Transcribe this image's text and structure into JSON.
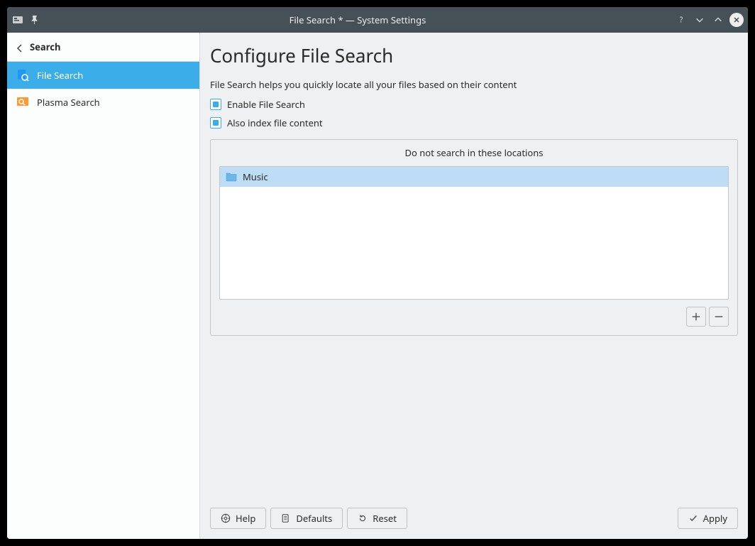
{
  "window": {
    "title": "File Search * — System Settings"
  },
  "sidebar": {
    "header": "Search",
    "items": [
      {
        "label": "File Search",
        "selected": true
      },
      {
        "label": "Plasma Search",
        "selected": false
      }
    ]
  },
  "main": {
    "title": "Configure File Search",
    "description": "File Search helps you quickly locate all your files based on their content",
    "checkboxes": {
      "enable": {
        "label": "Enable File Search",
        "checked": true
      },
      "index_content": {
        "label": "Also index file content",
        "checked": true
      }
    },
    "exclusion": {
      "title": "Do not search in these locations",
      "items": [
        {
          "label": "Music",
          "selected": true
        }
      ]
    }
  },
  "footer": {
    "help": "Help",
    "defaults": "Defaults",
    "reset": "Reset",
    "apply": "Apply"
  }
}
